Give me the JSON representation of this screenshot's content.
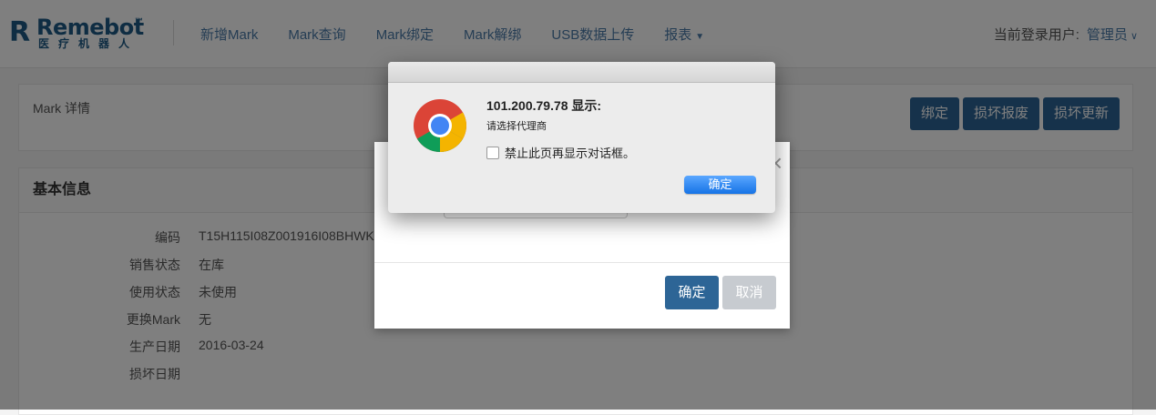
{
  "brand": {
    "name": "Remebot",
    "tm": "™",
    "subtitle": "医疗机器人"
  },
  "nav": {
    "items": [
      {
        "label": "新增Mark"
      },
      {
        "label": "Mark查询"
      },
      {
        "label": "Mark绑定"
      },
      {
        "label": "Mark解绑"
      },
      {
        "label": "USB数据上传"
      },
      {
        "label": "报表"
      }
    ],
    "user_label": "当前登录用户:",
    "user_name": "管理员"
  },
  "detail": {
    "title": "Mark 详情",
    "buttons": {
      "bind": "绑定",
      "scrap": "损坏报废",
      "replace": "损坏更新"
    }
  },
  "basic_info": {
    "title": "基本信息",
    "rows": [
      {
        "label": "编码",
        "value": "T15H115I08Z001916I08BHWK"
      },
      {
        "label": "销售状态",
        "value": "在库"
      },
      {
        "label": "使用状态",
        "value": "未使用"
      },
      {
        "label": "更换Mark",
        "value": "无"
      },
      {
        "label": "生产日期",
        "value": "2016-03-24"
      },
      {
        "label": "损坏日期",
        "value": ""
      }
    ]
  },
  "modal": {
    "ok_label": "确定",
    "cancel_label": "取消",
    "close_icon": "×"
  },
  "alert": {
    "host_line": "101.200.79.78 显示:",
    "message": "请选择代理商",
    "checkbox_label": "禁止此页再显示对话框。",
    "ok_label": "确定"
  },
  "colors": {
    "primary": "#2d6596",
    "nav_link": "#4a7aa8",
    "alert_button": "#1a7ef0"
  }
}
